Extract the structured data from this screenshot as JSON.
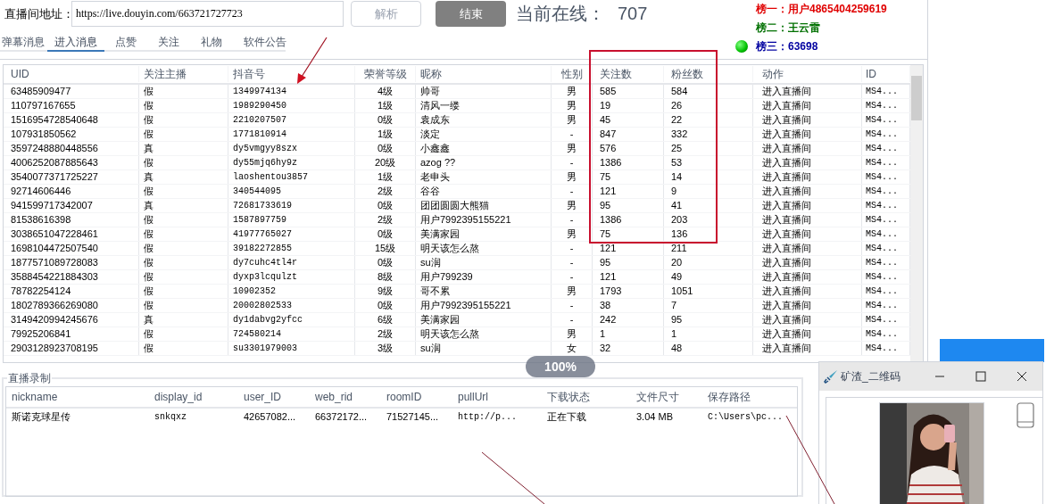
{
  "address": {
    "label": "直播间地址：",
    "value": "https://live.douyin.com/663721727723"
  },
  "buttons": [
    {
      "label": "解析",
      "disabled": true
    },
    {
      "label": "结束",
      "disabled": false
    }
  ],
  "online": {
    "label": "当前在线：",
    "count": "707"
  },
  "ranking": [
    {
      "label": "榜一：用户4865404259619",
      "color": "#e00000",
      "light": false
    },
    {
      "label": "榜二：王云雷",
      "color": "#007000",
      "light": false
    },
    {
      "label": "榜三：63698",
      "color": "#0000a0",
      "light": true
    }
  ],
  "tabs": [
    {
      "label": "弹幕消息",
      "selected": false
    },
    {
      "label": "进入消息",
      "selected": true
    },
    {
      "label": "点赞",
      "selected": false
    },
    {
      "label": "关注",
      "selected": false
    },
    {
      "label": "礼物",
      "selected": false
    },
    {
      "label": "软件公告",
      "selected": false
    }
  ],
  "table": {
    "columns": [
      "UID",
      "关注主播",
      "抖音号",
      "荣誉等级",
      "昵称",
      "性别",
      "关注数",
      "粉丝数",
      "动作",
      "ID"
    ],
    "rows": [
      [
        "63485909477",
        "假",
        "1349974134",
        "4级",
        "帅哥",
        "男",
        "585",
        "584",
        "进入直播间",
        "MS4..."
      ],
      [
        "110797167655",
        "假",
        "1989290450",
        "1级",
        "清风一缕",
        "男",
        "19",
        "26",
        "进入直播间",
        "MS4..."
      ],
      [
        "1516954728540648",
        "假",
        "2210207507",
        "0级",
        "袁成东",
        "男",
        "45",
        "22",
        "进入直播间",
        "MS4..."
      ],
      [
        "107931850562",
        "假",
        "1771810914",
        "1级",
        "淡定",
        "-",
        "847",
        "332",
        "进入直播间",
        "MS4..."
      ],
      [
        "3597248880448556",
        "真",
        "dy5vmgyy8szx",
        "0级",
        "小鑫鑫",
        "男",
        "576",
        "25",
        "进入直播间",
        "MS4..."
      ],
      [
        "4006252087885643",
        "假",
        "dy55mjq6hy9z",
        "20级",
        "azog ??",
        "-",
        "1386",
        "53",
        "进入直播间",
        "MS4..."
      ],
      [
        "3540077371725227",
        "真",
        "laoshentou3857",
        "1级",
        "老申头",
        "男",
        "75",
        "14",
        "进入直播间",
        "MS4..."
      ],
      [
        "92714606446",
        "假",
        "340544095",
        "2级",
        "谷谷",
        "-",
        "121",
        "9",
        "进入直播间",
        "MS4..."
      ],
      [
        "941599717342007",
        "真",
        "72681733619",
        "0级",
        "团团圆圆大熊猫",
        "男",
        "95",
        "41",
        "进入直播间",
        "MS4..."
      ],
      [
        "81538616398",
        "假",
        "1587897759",
        "2级",
        "用户7992395155221",
        "-",
        "1386",
        "203",
        "进入直播间",
        "MS4..."
      ],
      [
        "3038651047228461",
        "假",
        "41977765027",
        "0级",
        "美满家园",
        "男",
        "75",
        "136",
        "进入直播间",
        "MS4..."
      ],
      [
        "1698104472507540",
        "假",
        "39182272855",
        "15级",
        "明天该怎么熬",
        "-",
        "121",
        "211",
        "进入直播间",
        "MS4..."
      ],
      [
        "1877571089728083",
        "假",
        "dy7cuhc4tl4r",
        "0级",
        "su润",
        "-",
        "95",
        "20",
        "进入直播间",
        "MS4..."
      ],
      [
        "3588454221884303",
        "假",
        "dyxp3lcqulzt",
        "8级",
        "用户799239",
        "-",
        "121",
        "49",
        "进入直播间",
        "MS4..."
      ],
      [
        "78782254124",
        "假",
        "10902352",
        "9级",
        "哥不累",
        "男",
        "1793",
        "1051",
        "进入直播间",
        "MS4..."
      ],
      [
        "1802789366269080",
        "假",
        "20002802533",
        "0级",
        "用户7992395155221",
        "-",
        "38",
        "7",
        "进入直播间",
        "MS4..."
      ],
      [
        "3149420994245676",
        "真",
        "dy1dabvg2yfcc",
        "6级",
        "美满家园",
        "-",
        "242",
        "95",
        "进入直播间",
        "MS4..."
      ],
      [
        "79925206841",
        "假",
        "724580214",
        "2级",
        "明天该怎么熬",
        "男",
        "1",
        "1",
        "进入直播间",
        "MS4..."
      ],
      [
        "2903128923708195",
        "假",
        "su3301979003",
        "3级",
        "su润",
        "女",
        "32",
        "48",
        "进入直播间",
        "MS4..."
      ]
    ]
  },
  "zoom_badge": "100%",
  "recording": {
    "title": "直播录制",
    "columns": [
      "nickname",
      "display_id",
      "user_ID",
      "web_rid",
      "roomID",
      "pullUrl",
      "下载状态",
      "文件尺寸",
      "保存路径"
    ],
    "rows": [
      [
        "斯诺克球星传",
        "snkqxz",
        "42657082...",
        "66372172...",
        "71527145...",
        "http://p...",
        "正在下载",
        "3.04 MB",
        "C:\\Users\\pc..."
      ]
    ]
  },
  "qr_window": {
    "title": "矿渣_二维码"
  }
}
